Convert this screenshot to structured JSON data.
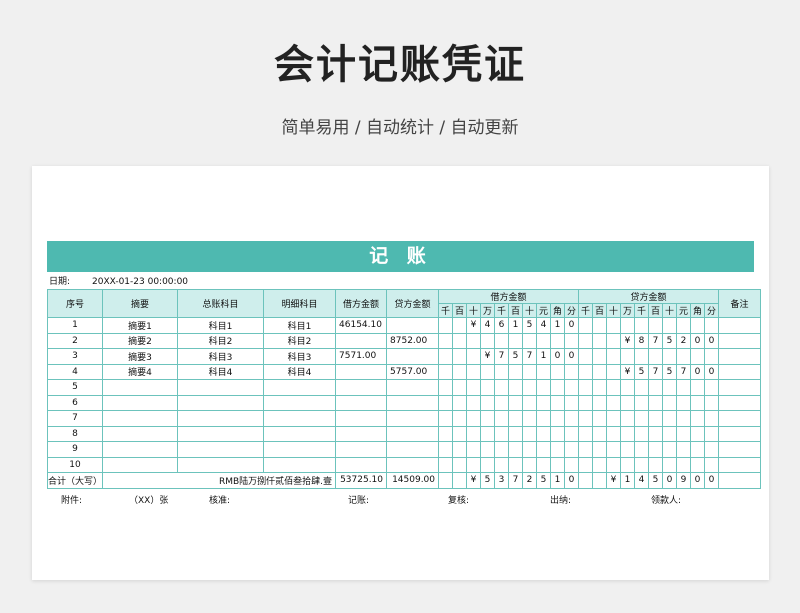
{
  "title": "会计记账凭证",
  "subtitle": "简单易用 / 自动统计 / 自动更新",
  "voucher": {
    "banner": "记 账",
    "date_label": "日期:",
    "date_value": "20XX-01-23 00:00:00",
    "headers": {
      "seq": "序号",
      "summary": "摘要",
      "general_account": "总账科目",
      "detail_account": "明细科目",
      "debit_amount": "借方金额",
      "credit_amount": "贷方金额",
      "debit_group": "借方金额",
      "credit_group": "贷方金额",
      "remark": "备注"
    },
    "digit_headers": [
      "千",
      "百",
      "十",
      "万",
      "千",
      "百",
      "十",
      "元",
      "角",
      "分"
    ],
    "rows": [
      {
        "seq": "1",
        "summary": "摘要1",
        "general": "科目1",
        "detail": "科目1",
        "debit": "46154.10",
        "credit": "",
        "debit_digits": [
          "",
          "",
          "¥",
          "4",
          "6",
          "1",
          "5",
          "4",
          "1",
          "0"
        ],
        "credit_digits": [
          "",
          "",
          "",
          "",
          "",
          "",
          "",
          "",
          "",
          ""
        ]
      },
      {
        "seq": "2",
        "summary": "摘要2",
        "general": "科目2",
        "detail": "科目2",
        "debit": "",
        "credit": "8752.00",
        "debit_digits": [
          "",
          "",
          "",
          "",
          "",
          "",
          "",
          "",
          "",
          ""
        ],
        "credit_digits": [
          "",
          "",
          "",
          "¥",
          "8",
          "7",
          "5",
          "2",
          "0",
          "0"
        ]
      },
      {
        "seq": "3",
        "summary": "摘要3",
        "general": "科目3",
        "detail": "科目3",
        "debit": "7571.00",
        "credit": "",
        "debit_digits": [
          "",
          "",
          "",
          "¥",
          "7",
          "5",
          "7",
          "1",
          "0",
          "0"
        ],
        "credit_digits": [
          "",
          "",
          "",
          "",
          "",
          "",
          "",
          "",
          "",
          ""
        ]
      },
      {
        "seq": "4",
        "summary": "摘要4",
        "general": "科目4",
        "detail": "科目4",
        "debit": "",
        "credit": "5757.00",
        "debit_digits": [
          "",
          "",
          "",
          "",
          "",
          "",
          "",
          "",
          "",
          ""
        ],
        "credit_digits": [
          "",
          "",
          "",
          "¥",
          "5",
          "7",
          "5",
          "7",
          "0",
          "0"
        ]
      },
      {
        "seq": "5",
        "summary": "",
        "general": "",
        "detail": "",
        "debit": "",
        "credit": "",
        "debit_digits": [
          "",
          "",
          "",
          "",
          "",
          "",
          "",
          "",
          "",
          ""
        ],
        "credit_digits": [
          "",
          "",
          "",
          "",
          "",
          "",
          "",
          "",
          "",
          ""
        ]
      },
      {
        "seq": "6",
        "summary": "",
        "general": "",
        "detail": "",
        "debit": "",
        "credit": "",
        "debit_digits": [
          "",
          "",
          "",
          "",
          "",
          "",
          "",
          "",
          "",
          ""
        ],
        "credit_digits": [
          "",
          "",
          "",
          "",
          "",
          "",
          "",
          "",
          "",
          ""
        ]
      },
      {
        "seq": "7",
        "summary": "",
        "general": "",
        "detail": "",
        "debit": "",
        "credit": "",
        "debit_digits": [
          "",
          "",
          "",
          "",
          "",
          "",
          "",
          "",
          "",
          ""
        ],
        "credit_digits": [
          "",
          "",
          "",
          "",
          "",
          "",
          "",
          "",
          "",
          ""
        ]
      },
      {
        "seq": "8",
        "summary": "",
        "general": "",
        "detail": "",
        "debit": "",
        "credit": "",
        "debit_digits": [
          "",
          "",
          "",
          "",
          "",
          "",
          "",
          "",
          "",
          ""
        ],
        "credit_digits": [
          "",
          "",
          "",
          "",
          "",
          "",
          "",
          "",
          "",
          ""
        ]
      },
      {
        "seq": "9",
        "summary": "",
        "general": "",
        "detail": "",
        "debit": "",
        "credit": "",
        "debit_digits": [
          "",
          "",
          "",
          "",
          "",
          "",
          "",
          "",
          "",
          ""
        ],
        "credit_digits": [
          "",
          "",
          "",
          "",
          "",
          "",
          "",
          "",
          "",
          ""
        ]
      },
      {
        "seq": "10",
        "summary": "",
        "general": "",
        "detail": "",
        "debit": "",
        "credit": "",
        "debit_digits": [
          "",
          "",
          "",
          "",
          "",
          "",
          "",
          "",
          "",
          ""
        ],
        "credit_digits": [
          "",
          "",
          "",
          "",
          "",
          "",
          "",
          "",
          "",
          ""
        ]
      }
    ],
    "total": {
      "label": "合计（大写）",
      "uppercase": "RMB陆万捌仟贰佰叁拾肆.壹",
      "debit": "53725.10",
      "credit": "14509.00",
      "debit_digits": [
        "",
        "",
        "¥",
        "5",
        "3",
        "7",
        "2",
        "5",
        "1",
        "0"
      ],
      "credit_digits": [
        "",
        "",
        "¥",
        "1",
        "4",
        "5",
        "0",
        "9",
        "0",
        "0"
      ]
    },
    "footer": {
      "attachment": "附件:",
      "attachment_count": "（XX）张",
      "approve": "核准:",
      "bookkeeper": "记账:",
      "review": "复核:",
      "cashier": "出纳:",
      "receiver": "领款人:"
    },
    "colors": {
      "accent": "#4eb9b0",
      "header_bg": "#cfeeec",
      "border": "#6cc3bc"
    }
  }
}
